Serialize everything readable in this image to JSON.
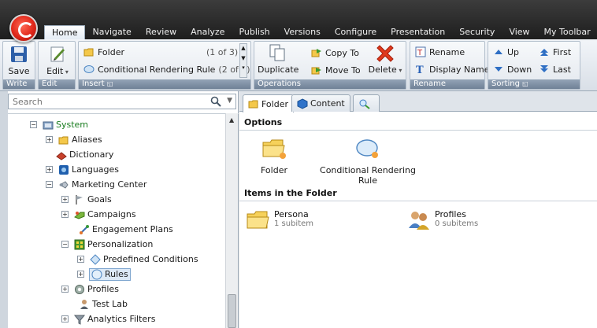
{
  "app": {
    "menu_tabs": [
      "Home",
      "Navigate",
      "Review",
      "Analyze",
      "Publish",
      "Versions",
      "Configure",
      "Presentation",
      "Security",
      "View",
      "My Toolbar"
    ],
    "active_tab": "Home"
  },
  "ribbon": {
    "write": {
      "label": "Write",
      "save": "Save"
    },
    "edit": {
      "label": "Edit",
      "edit": "Edit"
    },
    "insert": {
      "label": "Insert",
      "items": [
        {
          "name": "Folder",
          "count": "(1 of 3)"
        },
        {
          "name": "Conditional Rendering Rule",
          "count": "(2 of 3)"
        }
      ]
    },
    "operations": {
      "label": "Operations",
      "duplicate": "Duplicate",
      "copy_to": "Copy To",
      "move_to": "Move To",
      "delete": "Delete"
    },
    "rename": {
      "label": "Rename",
      "rename": "Rename",
      "display_name": "Display Name"
    },
    "sorting": {
      "label": "Sorting",
      "up": "Up",
      "down": "Down",
      "first": "First",
      "last": "Last"
    }
  },
  "search": {
    "placeholder": "Search"
  },
  "tree": {
    "system": "System",
    "aliases": "Aliases",
    "dictionary": "Dictionary",
    "languages": "Languages",
    "marketing_center": "Marketing Center",
    "goals": "Goals",
    "campaigns": "Campaigns",
    "engagement_plans": "Engagement Plans",
    "personalization": "Personalization",
    "predefined_conditions": "Predefined Conditions",
    "rules": "Rules",
    "profiles": "Profiles",
    "test_lab": "Test Lab",
    "analytics_filters": "Analytics Filters"
  },
  "editor": {
    "tabs": {
      "folder": "Folder",
      "content": "Content"
    },
    "options_title": "Options",
    "options": {
      "folder": "Folder",
      "conditional_rendering_rule": "Conditional Rendering Rule"
    },
    "items_title": "Items in the Folder",
    "items": [
      {
        "name": "Persona",
        "sub": "1 subitem"
      },
      {
        "name": "Profiles",
        "sub": "0 subitems"
      }
    ]
  },
  "colors": {
    "accent": "#6f8196",
    "system_green": "#197c1f",
    "selection": "#dce9f7"
  }
}
